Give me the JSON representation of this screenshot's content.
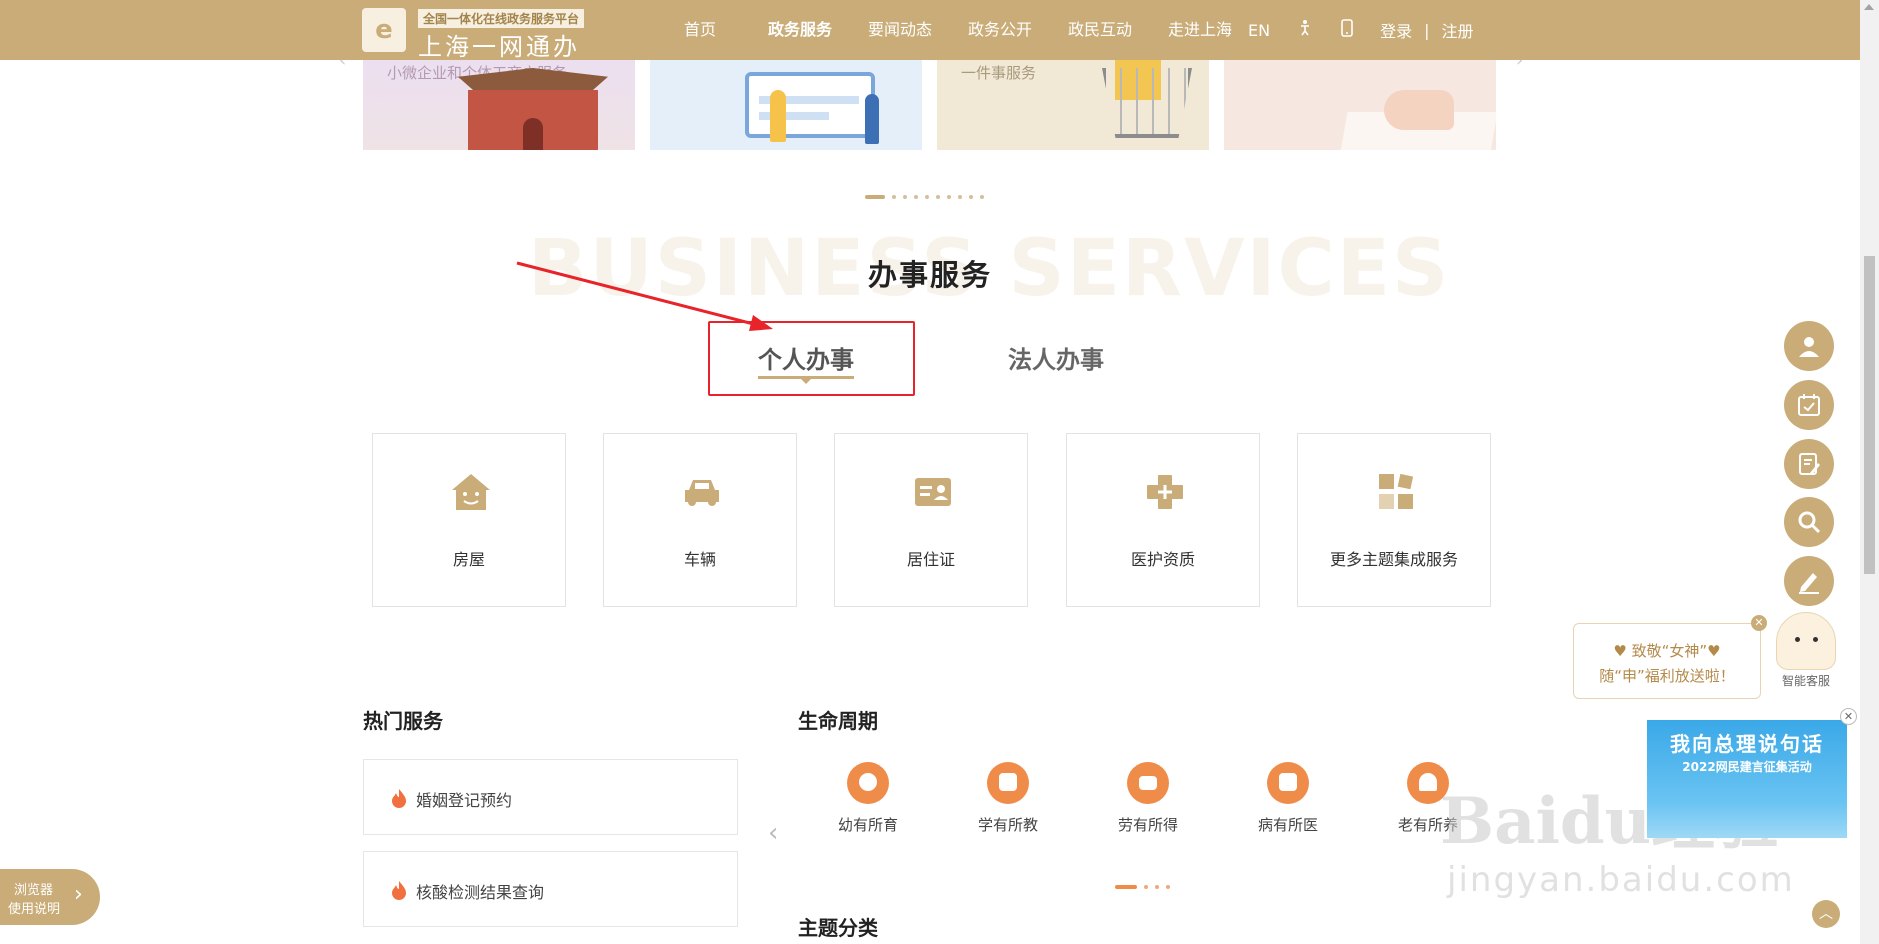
{
  "header": {
    "logo_glyph": "e",
    "logo_sub": "全国一体化在线政务服务平台",
    "logo_main": "上海一网通办",
    "nav": [
      "首页",
      "政务服务",
      "要闻动态",
      "政务公开",
      "政民互动",
      "走进上海"
    ],
    "active_nav": "政务服务",
    "lang": "EN",
    "login": "登录",
    "separator": "|",
    "register": "注册"
  },
  "banners": [
    {
      "text": "小微企业和个体工商户服务"
    },
    {
      "text": ""
    },
    {
      "text": "一件事服务"
    },
    {
      "text": ""
    }
  ],
  "business": {
    "bg_title": "BUSINESS SERVICES",
    "title": "办事服务",
    "tabs": [
      "个人办事",
      "法人办事"
    ],
    "cards": [
      {
        "label": "房屋",
        "icon": "house-icon"
      },
      {
        "label": "车辆",
        "icon": "car-icon"
      },
      {
        "label": "居住证",
        "icon": "residence-card-icon"
      },
      {
        "label": "医护资质",
        "icon": "medical-cross-icon"
      },
      {
        "label": "更多主题集成服务",
        "icon": "more-grid-icon"
      }
    ]
  },
  "hot": {
    "title": "热门服务",
    "items": [
      "婚姻登记预约",
      "核酸检测结果查询"
    ]
  },
  "life": {
    "title": "生命周期",
    "items": [
      "幼有所育",
      "学有所教",
      "劳有所得",
      "病有所医",
      "老有所养"
    ]
  },
  "theme": {
    "title": "主题分类"
  },
  "float": {
    "bubble_line1": "♥ 致敬“女神”♥",
    "bubble_line2": "随“申”福利放送啦！",
    "bot_label": "智能客服",
    "promo_line1": "我向总理说句话",
    "promo_line2": "2022网民建言征集活动"
  },
  "browser_tip": {
    "line1": "浏览器",
    "line2": "使用说明"
  },
  "watermark": {
    "line1": "Baidu经验",
    "line2": "jingyan.baidu.com"
  },
  "colors": {
    "brand": "#c9ac78",
    "accent_red": "#e8232a",
    "life_orange": "#f08c4a"
  }
}
